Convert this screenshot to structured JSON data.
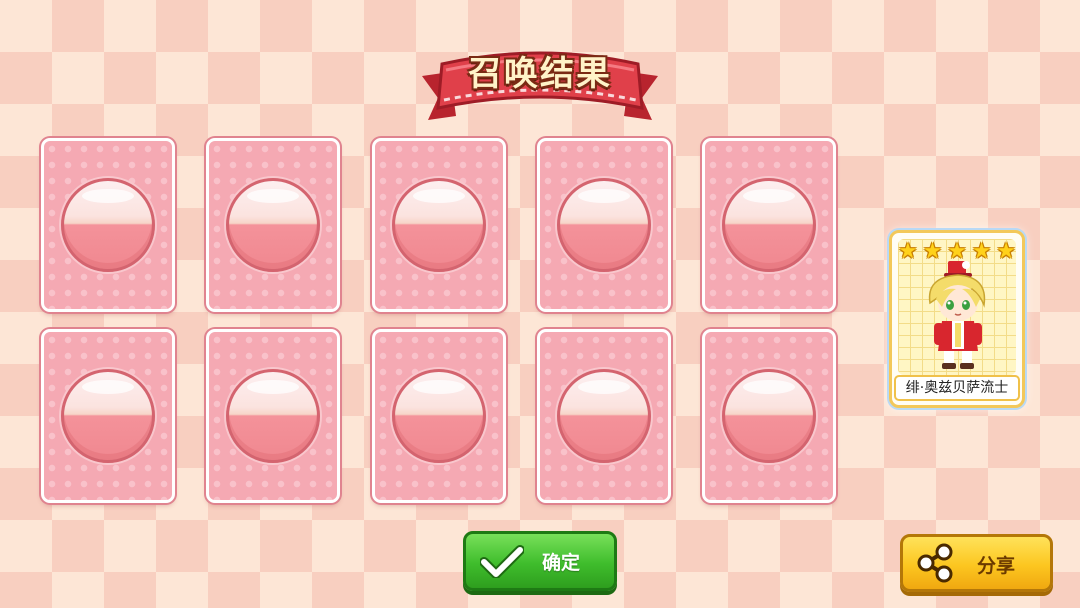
{
  "title": "召唤结果",
  "cards": [
    {
      "id": 1
    },
    {
      "id": 2
    },
    {
      "id": 3
    },
    {
      "id": 4
    },
    {
      "id": 5
    },
    {
      "id": 6
    },
    {
      "id": 7
    },
    {
      "id": 8
    },
    {
      "id": 9
    },
    {
      "id": 10
    }
  ],
  "character": {
    "name": "绯·奥兹贝萨流士",
    "stars": 5
  },
  "buttons": {
    "confirm_label": "确定",
    "share_label": "分享"
  },
  "colors": {
    "card_pink": "#f5a9b3",
    "confirm_green": "#3fbd2c",
    "share_yellow": "#fcc620",
    "ribbon_red": "#e0404a"
  },
  "icons": {
    "confirm": "check-icon",
    "share": "share-icon",
    "star": "star-icon"
  }
}
